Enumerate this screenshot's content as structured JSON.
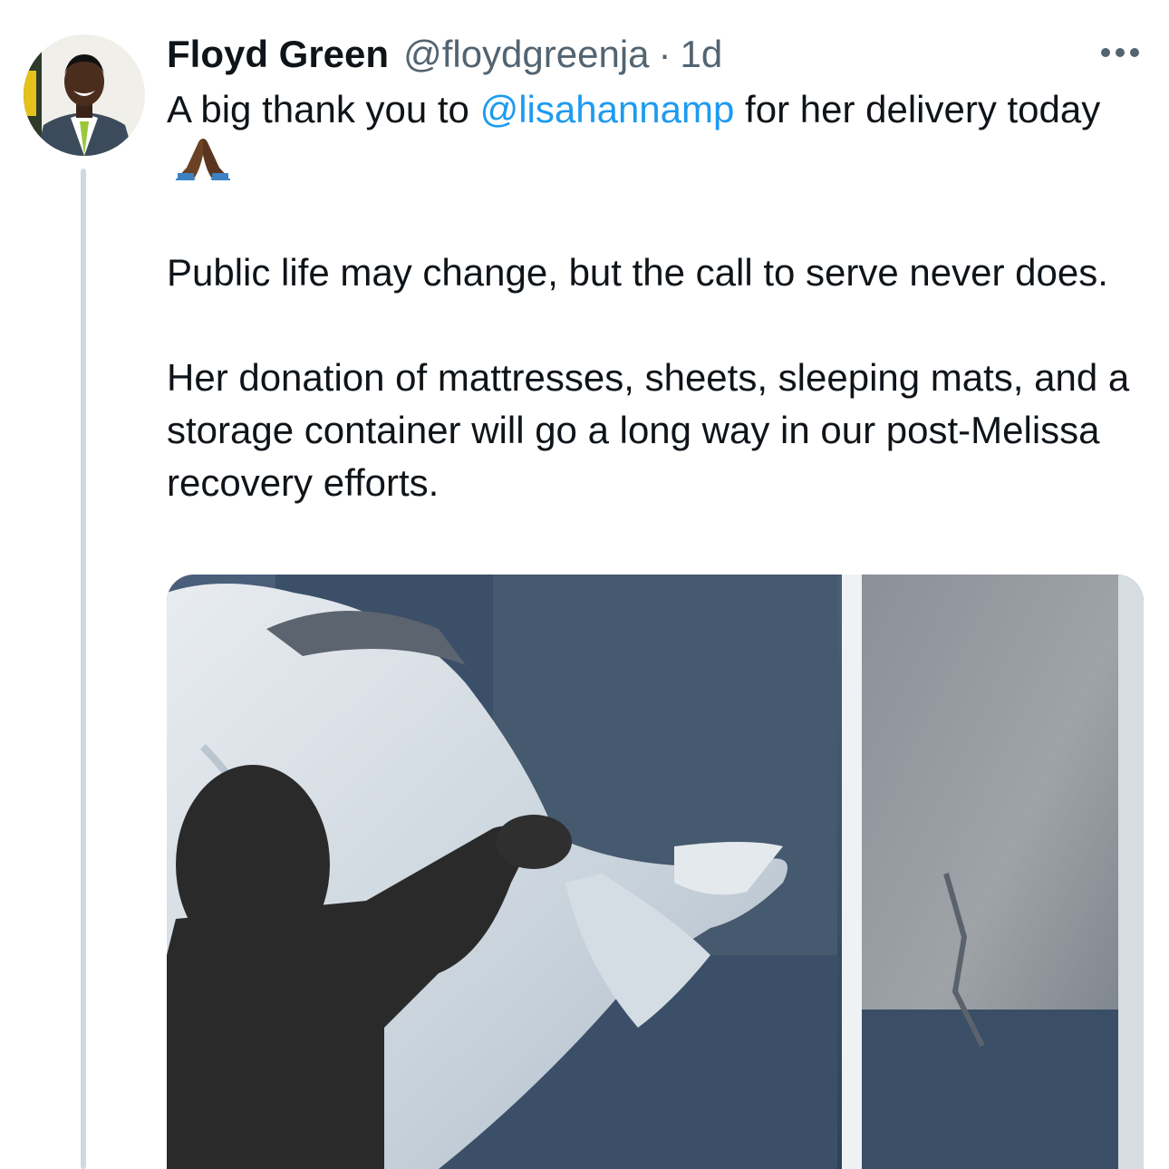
{
  "tweet": {
    "author_name": "Floyd Green",
    "author_handle": "@floydgreenja",
    "separator": "·",
    "timestamp": "1d",
    "text": {
      "line1_before_mention": "A big thank you to ",
      "mention": "@lisahannamp",
      "line1_after_mention": " for her delivery today",
      "emoji": "folded-hands",
      "paragraph2": "Public life may change, but the call to serve never does.",
      "paragraph3": "Her donation of mattresses, sheets, sleeping mats, and a storage container will go a long way in our post-Melissa recovery efforts."
    },
    "icons": {
      "more": "more-horizontal-icon"
    },
    "colors": {
      "link": "#1d9bf0",
      "secondary_text": "#536471",
      "thread_line": "#cfd9de"
    }
  }
}
